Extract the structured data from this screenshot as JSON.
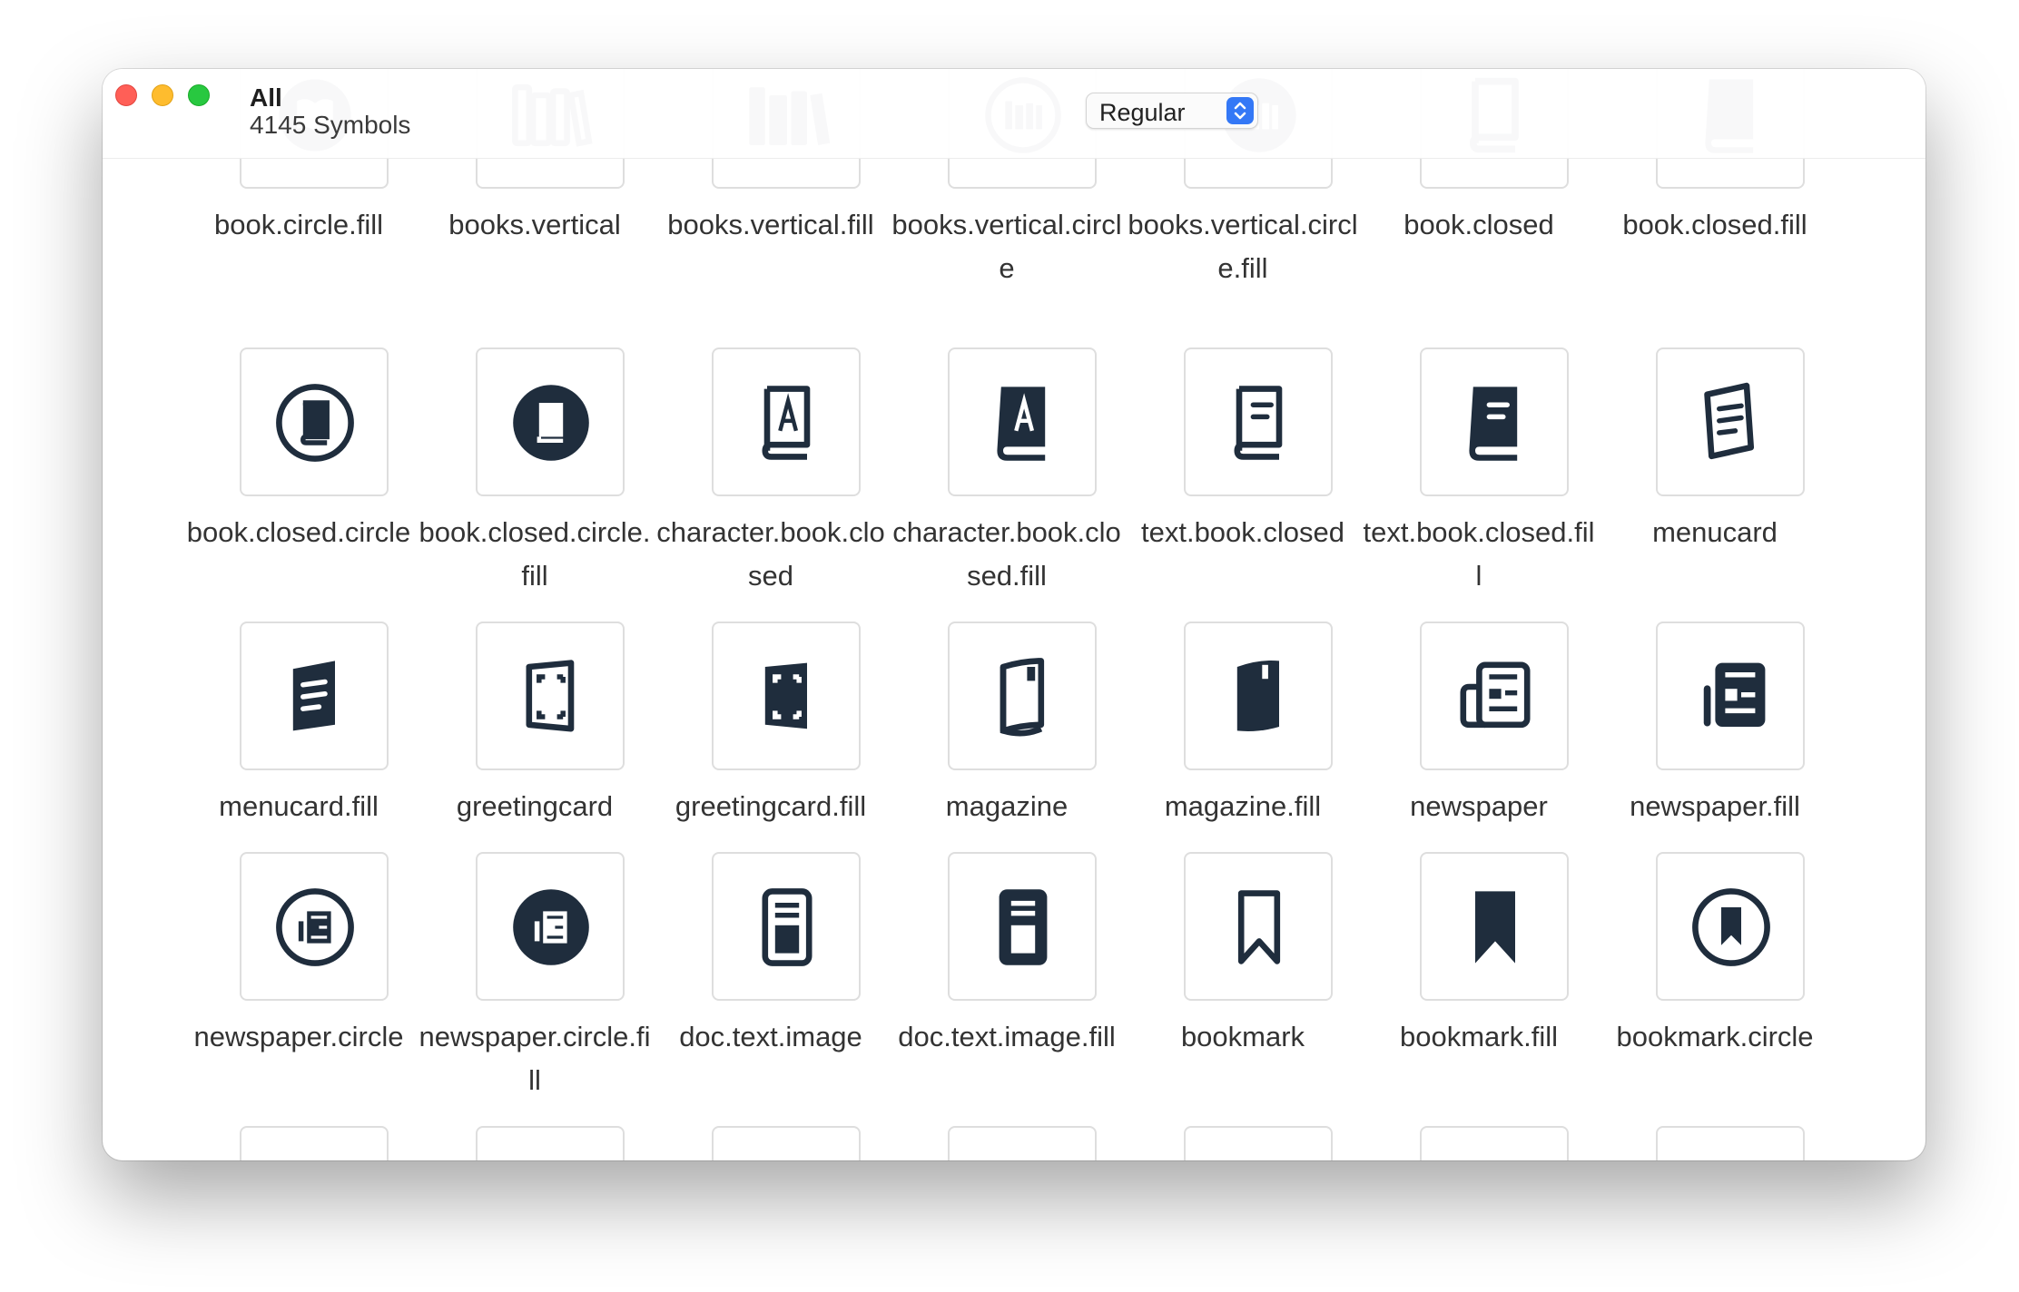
{
  "window": {
    "title": "All",
    "subtitle": "4145 Symbols",
    "weight_popup": {
      "value": "Regular",
      "icon": "chevron-up-down-icon"
    }
  },
  "rows": [
    [
      {
        "name": "book.circle.fill",
        "icon": "book-circle-fill-icon"
      },
      {
        "name": "books.vertical",
        "icon": "books-vertical-icon"
      },
      {
        "name": "books.vertical.fill",
        "icon": "books-vertical-fill-icon"
      },
      {
        "name": "books.vertical.circle",
        "icon": "books-vertical-circle-icon"
      },
      {
        "name": "books.vertical.circle.fill",
        "icon": "books-vertical-circle-fill-icon"
      },
      {
        "name": "book.closed",
        "icon": "book-closed-icon"
      },
      {
        "name": "book.closed.fill",
        "icon": "book-closed-fill-icon"
      }
    ],
    [
      {
        "name": "book.closed.circle",
        "icon": "book-closed-circle-icon"
      },
      {
        "name": "book.closed.circle.fill",
        "icon": "book-closed-circle-fill-icon"
      },
      {
        "name": "character.book.closed",
        "icon": "character-book-closed-icon"
      },
      {
        "name": "character.book.closed.fill",
        "icon": "character-book-closed-fill-icon"
      },
      {
        "name": "text.book.closed",
        "icon": "text-book-closed-icon"
      },
      {
        "name": "text.book.closed.fill",
        "icon": "text-book-closed-fill-icon"
      },
      {
        "name": "menucard",
        "icon": "menucard-icon"
      }
    ],
    [
      {
        "name": "menucard.fill",
        "icon": "menucard-fill-icon"
      },
      {
        "name": "greetingcard",
        "icon": "greetingcard-icon"
      },
      {
        "name": "greetingcard.fill",
        "icon": "greetingcard-fill-icon"
      },
      {
        "name": "magazine",
        "icon": "magazine-icon"
      },
      {
        "name": "magazine.fill",
        "icon": "magazine-fill-icon"
      },
      {
        "name": "newspaper",
        "icon": "newspaper-icon"
      },
      {
        "name": "newspaper.fill",
        "icon": "newspaper-fill-icon"
      }
    ],
    [
      {
        "name": "newspaper.circle",
        "icon": "newspaper-circle-icon"
      },
      {
        "name": "newspaper.circle.fill",
        "icon": "newspaper-circle-fill-icon"
      },
      {
        "name": "doc.text.image",
        "icon": "doc-text-image-icon"
      },
      {
        "name": "doc.text.image.fill",
        "icon": "doc-text-image-fill-icon"
      },
      {
        "name": "bookmark",
        "icon": "bookmark-icon"
      },
      {
        "name": "bookmark.fill",
        "icon": "bookmark-fill-icon"
      },
      {
        "name": "bookmark.circle",
        "icon": "bookmark-circle-icon"
      }
    ]
  ],
  "colors": {
    "icon": "#1f2d3d",
    "tile_border": "#dedede",
    "label": "#333333"
  }
}
